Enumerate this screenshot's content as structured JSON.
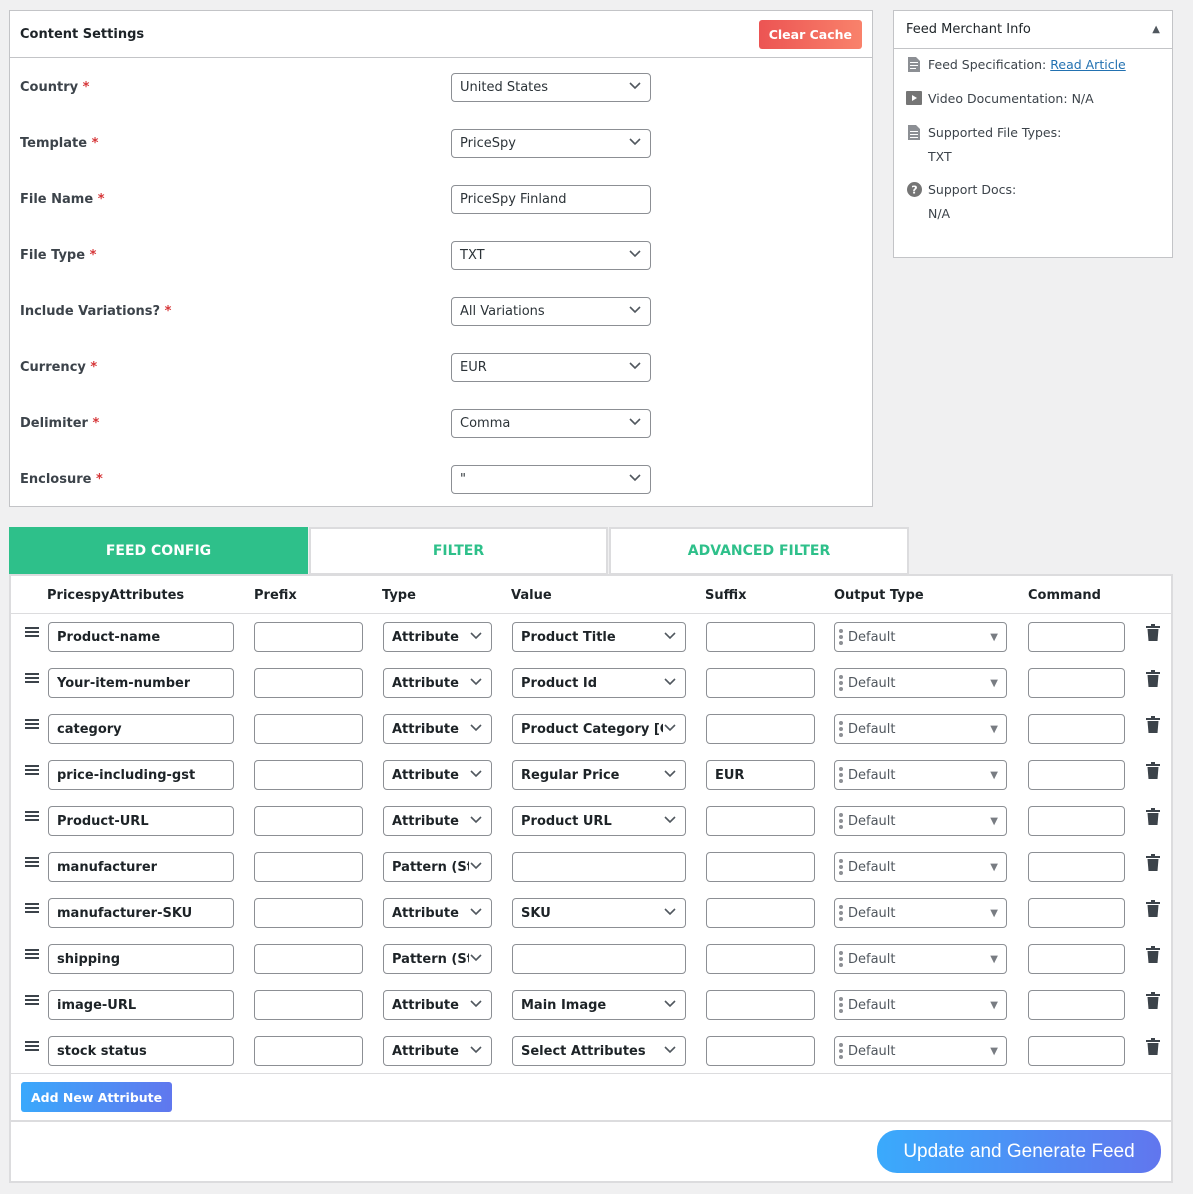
{
  "content_settings": {
    "title": "Content Settings",
    "clear_cache_label": "Clear Cache",
    "required_mark": "*",
    "fields": [
      {
        "label": "Country",
        "value": "United States",
        "kind": "select"
      },
      {
        "label": "Template",
        "value": "PriceSpy",
        "kind": "select"
      },
      {
        "label": "File Name",
        "value": "PriceSpy Finland",
        "kind": "input"
      },
      {
        "label": "File Type",
        "value": "TXT",
        "kind": "select"
      },
      {
        "label": "Include Variations?",
        "value": "All Variations",
        "kind": "select"
      },
      {
        "label": "Currency",
        "value": "EUR",
        "kind": "select"
      },
      {
        "label": "Delimiter",
        "value": "Comma",
        "kind": "select"
      },
      {
        "label": "Enclosure",
        "value": "\"",
        "kind": "select"
      }
    ]
  },
  "merchant_info": {
    "title": "Feed Merchant Info",
    "feed_spec_label": "Feed Specification:",
    "feed_spec_link": "Read Article",
    "video_label": "Video Documentation:",
    "video_value": "N/A",
    "file_types_label": "Supported File Types:",
    "file_types_value": "TXT",
    "support_docs_label": "Support Docs:",
    "support_docs_value": "N/A"
  },
  "tabs": [
    {
      "label": "FEED CONFIG",
      "active": true
    },
    {
      "label": "FILTER",
      "active": false
    },
    {
      "label": "ADVANCED FILTER",
      "active": false
    }
  ],
  "table": {
    "headers": [
      "PricespyAttributes",
      "Prefix",
      "Type",
      "Value",
      "Suffix",
      "Output Type",
      "Command"
    ],
    "rows": [
      {
        "attribute": "Product-name",
        "prefix": "",
        "type": "Attribute",
        "value": "Product Title",
        "suffix": "",
        "output": "Default",
        "command": ""
      },
      {
        "attribute": "Your-item-number",
        "prefix": "",
        "type": "Attribute",
        "value": "Product Id",
        "suffix": "",
        "output": "Default",
        "command": ""
      },
      {
        "attribute": "category",
        "prefix": "",
        "type": "Attribute",
        "value": "Product Category [Ca",
        "suffix": "",
        "output": "Default",
        "command": ""
      },
      {
        "attribute": "price-including-gst",
        "prefix": "",
        "type": "Attribute",
        "value": "Regular Price",
        "suffix": "EUR",
        "output": "Default",
        "command": ""
      },
      {
        "attribute": "Product-URL",
        "prefix": "",
        "type": "Attribute",
        "value": "Product URL",
        "suffix": "",
        "output": "Default",
        "command": ""
      },
      {
        "attribute": "manufacturer",
        "prefix": "",
        "type": "Pattern (Sta",
        "value": "",
        "suffix": "",
        "output": "Default",
        "command": ""
      },
      {
        "attribute": "manufacturer-SKU",
        "prefix": "",
        "type": "Attribute",
        "value": "SKU",
        "suffix": "",
        "output": "Default",
        "command": ""
      },
      {
        "attribute": "shipping",
        "prefix": "",
        "type": "Pattern (Sta",
        "value": "",
        "suffix": "",
        "output": "Default",
        "command": ""
      },
      {
        "attribute": "image-URL",
        "prefix": "",
        "type": "Attribute",
        "value": "Main Image",
        "suffix": "",
        "output": "Default",
        "command": ""
      },
      {
        "attribute": "stock status",
        "prefix": "",
        "type": "Attribute",
        "value": "Select Attributes",
        "suffix": "",
        "output": "Default",
        "command": ""
      }
    ],
    "value_is_select": [
      true,
      true,
      true,
      true,
      true,
      false,
      true,
      false,
      true,
      true
    ]
  },
  "add_attribute_label": "Add New Attribute",
  "update_label": "Update and Generate Feed",
  "colors": {
    "accent_green": "#2ec08a",
    "danger": "#ec5453",
    "link": "#2271b1",
    "gradient_blue": "#3aa9fc"
  }
}
